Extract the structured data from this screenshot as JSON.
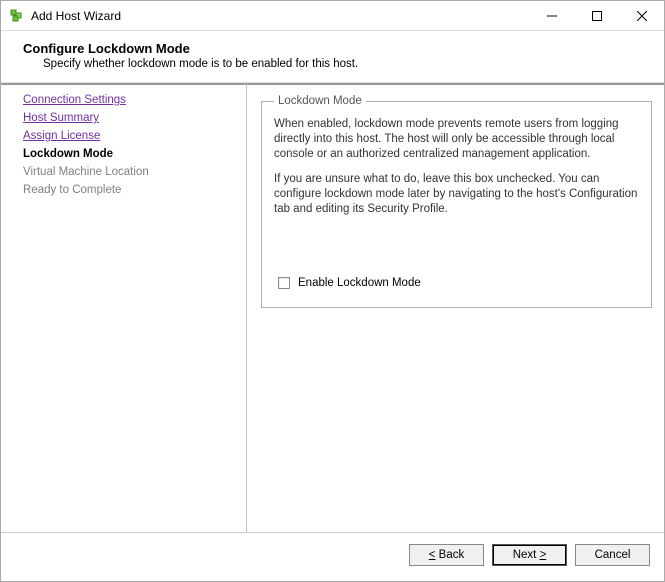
{
  "window": {
    "title": "Add Host Wizard"
  },
  "header": {
    "title": "Configure Lockdown Mode",
    "subtitle": "Specify whether lockdown mode is to be enabled for this host."
  },
  "steps": {
    "connection_settings": "Connection Settings",
    "host_summary": "Host Summary",
    "assign_license": "Assign License",
    "lockdown_mode": "Lockdown Mode",
    "vm_location": "Virtual Machine Location",
    "ready": "Ready to Complete"
  },
  "group": {
    "legend": "Lockdown Mode",
    "para1": "When enabled, lockdown mode prevents remote users from logging directly into this host. The host will only be accessible through local console or an authorized centralized management application.",
    "para2": "If you are unsure what to do, leave this box unchecked. You can configure lockdown mode later by navigating to the host's Configuration tab and editing its Security Profile.",
    "checkbox_label": "Enable Lockdown Mode",
    "checked": false
  },
  "buttons": {
    "back_prefix": "<",
    "back_text": " Back",
    "next_text": "Next ",
    "next_suffix": ">",
    "cancel": "Cancel"
  }
}
